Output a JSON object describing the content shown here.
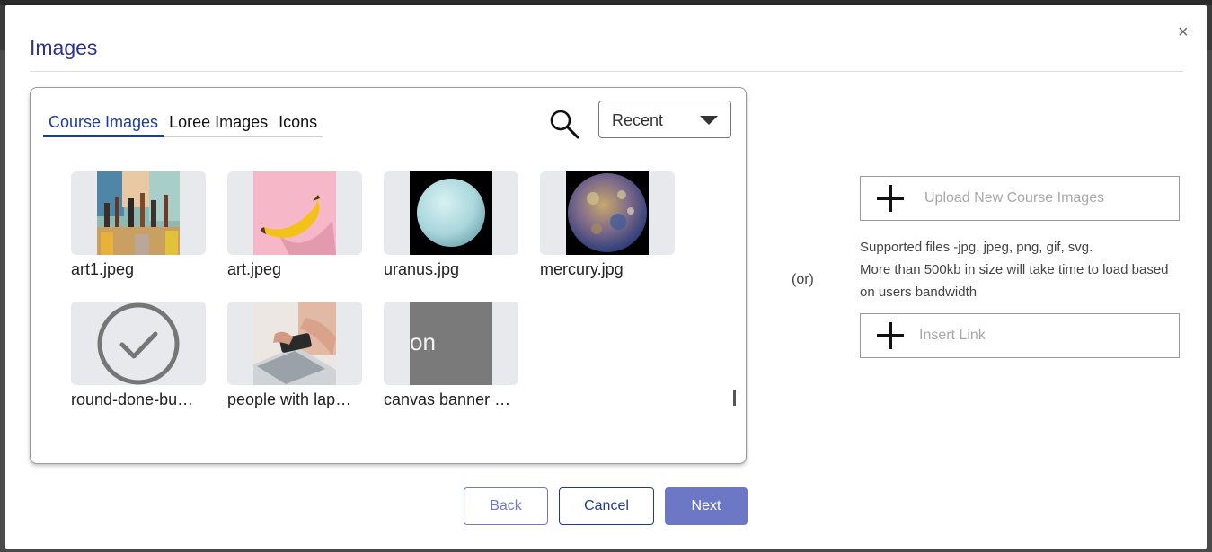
{
  "dialog": {
    "title": "Images",
    "close_label": "×"
  },
  "tabs": [
    {
      "label": "Course Images",
      "active": true
    },
    {
      "label": "Loree Images",
      "active": false
    },
    {
      "label": "Icons",
      "active": false
    }
  ],
  "filter": {
    "selected": "Recent"
  },
  "images": [
    {
      "name": "art1.jpeg"
    },
    {
      "name": "art.jpeg"
    },
    {
      "name": "uranus.jpg"
    },
    {
      "name": "mercury.jpg"
    },
    {
      "name": "round-done-bu…"
    },
    {
      "name": "people with lap…"
    },
    {
      "name": "canvas banner …"
    }
  ],
  "canvas_thumb_text": "on",
  "separator": "(or)",
  "upload": {
    "label": "Upload New Course Images",
    "help_line1": "Supported files -jpg, jpeg, png, gif, svg.",
    "help_line2": "More than 500kb in size will take time to load based on users bandwidth"
  },
  "insert_link": {
    "label": "Insert Link"
  },
  "footer": {
    "back_label": "Back",
    "cancel_label": "Cancel",
    "next_label": "Next"
  },
  "colors": {
    "title": "#2e3192",
    "active_tab": "#1d3d9c",
    "primary_button": "#6c78c6",
    "cancel_border": "#1f3a93"
  },
  "icons": [
    "search-icon",
    "caret-down-icon",
    "plus-icon",
    "close-icon",
    "check-circle-icon"
  ]
}
